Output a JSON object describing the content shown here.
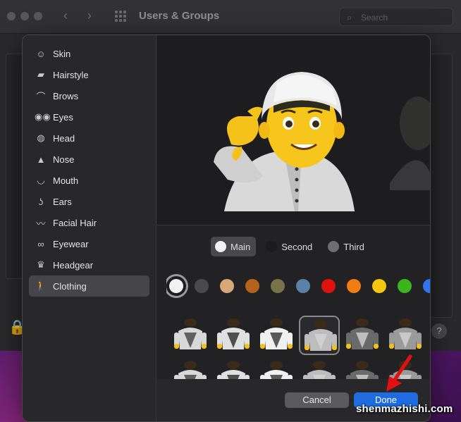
{
  "background_window": {
    "title": "Users & Groups",
    "search_placeholder": "Search",
    "help_label": "?"
  },
  "sidebar": {
    "items": [
      {
        "label": "Skin",
        "icon": "face-icon"
      },
      {
        "label": "Hairstyle",
        "icon": "comb-icon"
      },
      {
        "label": "Brows",
        "icon": "brows-icon"
      },
      {
        "label": "Eyes",
        "icon": "eyes-icon"
      },
      {
        "label": "Head",
        "icon": "head-icon"
      },
      {
        "label": "Nose",
        "icon": "nose-icon"
      },
      {
        "label": "Mouth",
        "icon": "mouth-icon"
      },
      {
        "label": "Ears",
        "icon": "ear-icon"
      },
      {
        "label": "Facial Hair",
        "icon": "mustache-icon"
      },
      {
        "label": "Eyewear",
        "icon": "glasses-icon"
      },
      {
        "label": "Headgear",
        "icon": "crown-icon"
      },
      {
        "label": "Clothing",
        "icon": "person-icon",
        "selected": true
      }
    ]
  },
  "color_tabs": [
    {
      "label": "Main",
      "color": "#f2f2f2",
      "active": true
    },
    {
      "label": "Second",
      "color": "#1c1c1e",
      "active": false
    },
    {
      "label": "Third",
      "color": "#6e6e70",
      "active": false
    }
  ],
  "swatches": [
    "#f2f2f2",
    "#4a4a4c",
    "#d7a77a",
    "#b3631c",
    "#777248",
    "#5b82a6",
    "#e0120e",
    "#f07c12",
    "#f6c711",
    "#3cb51c",
    "#2f74f0"
  ],
  "selected_swatch_index": 0,
  "clothing_items": 12,
  "selected_clothing_index": 3,
  "footer": {
    "cancel_label": "Cancel",
    "done_label": "Done"
  },
  "watermark": "shenmazhishi.com"
}
